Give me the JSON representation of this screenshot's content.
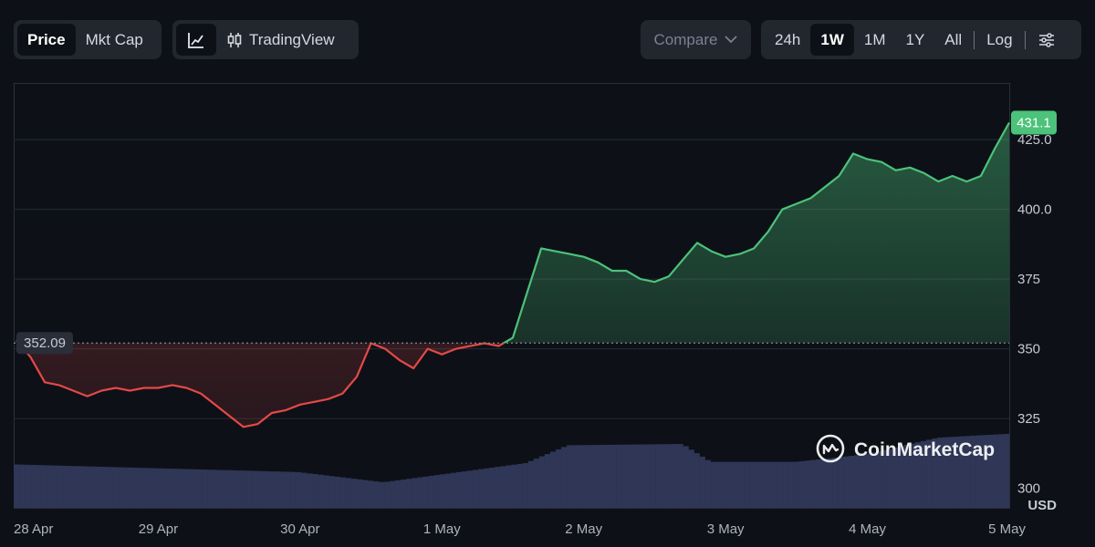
{
  "toolbar": {
    "metric_tabs": [
      {
        "label": "Price",
        "active": true
      },
      {
        "label": "Mkt Cap",
        "active": false
      }
    ],
    "view_icon": "line-chart-icon",
    "tradingview_icon": "candlestick-icon",
    "tradingview_label": "TradingView",
    "compare_label": "Compare",
    "compare_icon": "chevron-down-icon",
    "ranges": [
      {
        "label": "24h",
        "active": false
      },
      {
        "label": "1W",
        "active": true
      },
      {
        "label": "1M",
        "active": false
      },
      {
        "label": "1Y",
        "active": false
      },
      {
        "label": "All",
        "active": false
      }
    ],
    "log_label": "Log",
    "settings_icon": "sliders-icon"
  },
  "watermark": {
    "text": "CoinMarketCap",
    "icon": "coinmarketcap-logo-icon"
  },
  "colors": {
    "up": "#4cc27a",
    "down": "#e54848",
    "volume": "#2f3656",
    "background": "#0d1117"
  },
  "chart_data": {
    "type": "area",
    "x_axis": {
      "ticks": [
        "28 Apr",
        "29 Apr",
        "30 Apr",
        "1 May",
        "2 May",
        "3 May",
        "4 May",
        "5 May"
      ]
    },
    "y_axis": {
      "ticks": [
        300,
        325,
        350,
        375,
        400,
        425
      ],
      "range": [
        293,
        445
      ],
      "position": "right",
      "unit_label": "USD"
    },
    "baseline": {
      "value": 352.09,
      "label": "352.09"
    },
    "last_price": {
      "value": 431.1,
      "label": "431.1"
    },
    "grid": true,
    "series": [
      {
        "x": [
          0.0,
          0.1,
          0.2,
          0.3,
          0.4,
          0.5,
          0.6,
          0.7,
          0.8,
          0.9,
          1.0,
          1.1,
          1.2,
          1.3,
          1.4,
          1.5,
          1.6,
          1.7,
          1.8,
          1.9,
          2.0,
          2.1,
          2.2,
          2.3,
          2.4,
          2.5,
          2.6,
          2.7,
          2.8,
          2.9,
          3.0,
          3.1,
          3.2,
          3.3,
          3.4,
          3.5,
          3.6,
          3.7,
          3.8,
          3.9,
          4.0,
          4.1,
          4.2,
          4.3,
          4.4,
          4.5,
          4.6,
          4.7,
          4.8,
          4.9,
          5.0,
          5.1,
          5.2,
          5.3,
          5.4,
          5.5,
          5.6,
          5.7,
          5.8,
          5.9,
          6.0,
          6.1,
          6.2,
          6.3,
          6.4,
          6.5,
          6.6,
          6.7,
          6.8,
          6.9,
          7.0
        ],
        "y": [
          353,
          347,
          338,
          337,
          335,
          333,
          335,
          336,
          335,
          336,
          336,
          337,
          336,
          334,
          330,
          326,
          322,
          323,
          327,
          328,
          330,
          331,
          332,
          334,
          340,
          352,
          350,
          346,
          343,
          350,
          348,
          350,
          351,
          352,
          351,
          354,
          370,
          386,
          385,
          384,
          383,
          381,
          378,
          378,
          375,
          374,
          376,
          382,
          388,
          385,
          383,
          384,
          386,
          392,
          400,
          402,
          404,
          408,
          412,
          420,
          418,
          417,
          414,
          415,
          413,
          410,
          412,
          410,
          412,
          422,
          431.1
        ]
      }
    ],
    "volume": [
      {
        "x": 0.0,
        "rel": 0.34
      },
      {
        "x": 1.0,
        "rel": 0.31
      },
      {
        "x": 2.0,
        "rel": 0.28
      },
      {
        "x": 2.6,
        "rel": 0.2
      },
      {
        "x": 3.0,
        "rel": 0.26
      },
      {
        "x": 3.6,
        "rel": 0.35
      },
      {
        "x": 3.9,
        "rel": 0.49
      },
      {
        "x": 4.7,
        "rel": 0.5
      },
      {
        "x": 4.9,
        "rel": 0.36
      },
      {
        "x": 5.5,
        "rel": 0.36
      },
      {
        "x": 6.0,
        "rel": 0.42
      },
      {
        "x": 6.5,
        "rel": 0.55
      },
      {
        "x": 7.0,
        "rel": 0.58
      }
    ]
  }
}
